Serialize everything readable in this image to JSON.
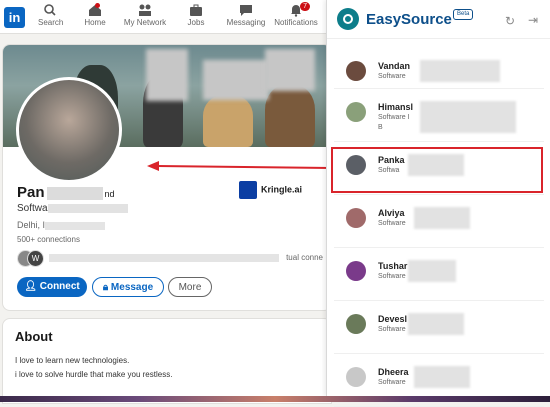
{
  "linkedin": {
    "logo_text": "in",
    "nav": [
      {
        "label": "Search",
        "icon": "search-icon"
      },
      {
        "label": "Home",
        "icon": "home-icon"
      },
      {
        "label": "My Network",
        "icon": "network-icon"
      },
      {
        "label": "Jobs",
        "icon": "jobs-icon"
      },
      {
        "label": "Messaging",
        "icon": "messaging-icon"
      },
      {
        "label": "Notifications",
        "icon": "bell-icon",
        "badge": "7"
      }
    ],
    "profile": {
      "name_visible": "Pan",
      "name_suffix": "nd",
      "headline_visible": "Softwa",
      "location_visible": "Delhi, I",
      "connections": "500+ connections",
      "mutual_suffix": "tual conne",
      "mutual_avatar_letter": "W",
      "company": "Kringle.ai",
      "buttons": {
        "connect": "Connect",
        "message": "Message",
        "more": "More"
      }
    },
    "about": {
      "title": "About",
      "line1": "I love to learn new technologies.",
      "line2": "i love to solve hurdle that make you restless."
    }
  },
  "easysource": {
    "title": "EasySource",
    "beta": "Beta",
    "candidates": [
      {
        "name": "Vandan",
        "role": "Software",
        "extra": ""
      },
      {
        "name": "Himansl",
        "role": "Software I",
        "extra": "B"
      },
      {
        "name": "Panka",
        "role": "Softwa",
        "extra": ""
      },
      {
        "name": "Alviya",
        "role": "Software",
        "extra": ""
      },
      {
        "name": "Tushar",
        "role": "Software",
        "extra": ""
      },
      {
        "name": "Devesl",
        "role": "Software",
        "extra": ""
      },
      {
        "name": "Dheera",
        "role": "Software",
        "extra": ""
      }
    ],
    "colors": {
      "brand": "#0d4f8a",
      "accent": "#0d7d8a",
      "highlight": "#d9242b"
    }
  }
}
